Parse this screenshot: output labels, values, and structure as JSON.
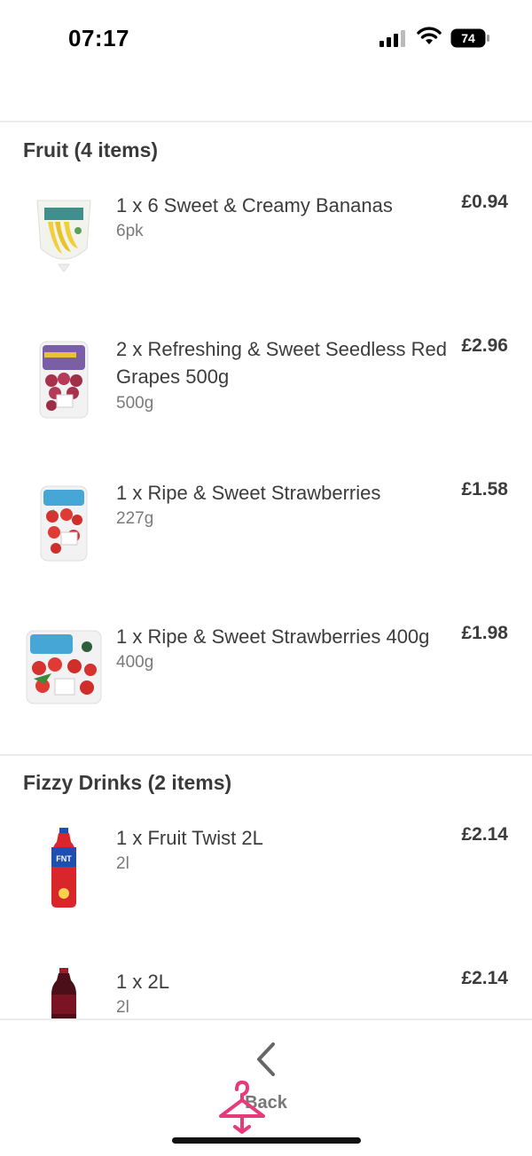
{
  "status_bar": {
    "time": "07:17",
    "battery_level": "74"
  },
  "sections": [
    {
      "title": "Fruit (4 items)",
      "items": [
        {
          "name": "1 x 6 Sweet & Creamy Bananas",
          "size": "6pk",
          "price": "£0.94",
          "icon": "bananas-icon"
        },
        {
          "name": "2 x Refreshing & Sweet Seedless Red Grapes 500g",
          "size": "500g",
          "price": "£2.96",
          "icon": "grapes-icon"
        },
        {
          "name": "1 x Ripe & Sweet Strawberries",
          "size": "227g",
          "price": "£1.58",
          "icon": "strawberries-icon"
        },
        {
          "name": "1 x Ripe & Sweet Strawberries 400g",
          "size": "400g",
          "price": "£1.98",
          "icon": "strawberries-400g-icon"
        }
      ]
    },
    {
      "title": "Fizzy Drinks (2 items)",
      "items": [
        {
          "name": "1 x Fruit Twist 2L",
          "size": "2l",
          "price": "£2.14",
          "icon": "fanta-bottle-icon"
        },
        {
          "name": "1 x 2L",
          "size": "2l",
          "price": "£2.14",
          "icon": "dr-pepper-bottle-icon"
        }
      ]
    }
  ],
  "bottom_bar": {
    "back_label": "Back"
  }
}
